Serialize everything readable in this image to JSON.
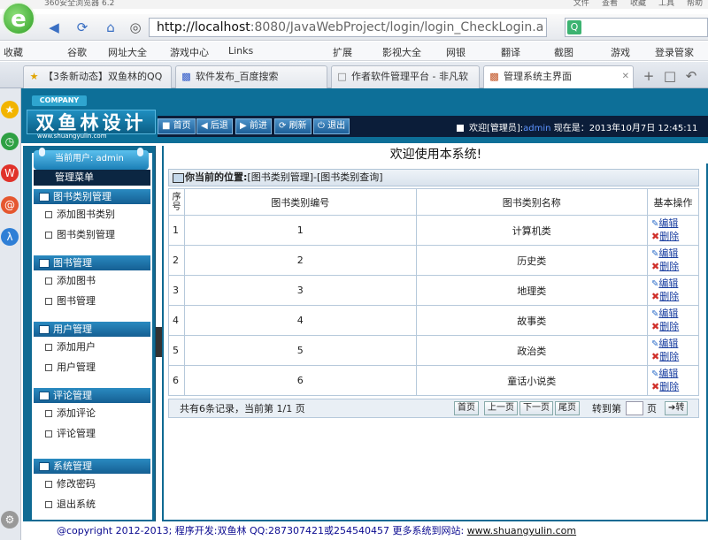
{
  "browser": {
    "title": "360安全浏览器 6.2",
    "menu": [
      "文件",
      "查看",
      "收藏",
      "工具",
      "帮助"
    ],
    "address_host": "http://localhost",
    "address_path": ":8080/JavaWebProject/login/login_CheckLogin.a",
    "bookmarks": [
      "收藏",
      "谷歌",
      "网址大全",
      "游戏中心",
      "Links",
      "扩展",
      "影视大全",
      "网银",
      "翻译",
      "截图",
      "游戏",
      "登录管家"
    ],
    "tabs": [
      {
        "label": "【3条新动态】双鱼林的QQ",
        "active": false
      },
      {
        "label": "软件发布_百度搜索",
        "active": false
      },
      {
        "label": "作者软件管理平台 - 非凡软",
        "active": false
      },
      {
        "label": "管理系统主界面",
        "active": true
      }
    ]
  },
  "header": {
    "company": "COMPANY",
    "brand": "双鱼林设计",
    "brand_url": "www.shuangyulin.com",
    "buttons": [
      "首页",
      "后退",
      "前进",
      "刷新",
      "退出"
    ],
    "welcome_prefix": "欢迎[管理员]:",
    "welcome_user": "admin",
    "welcome_time": "现在是：2013年10月7日  12:45:11"
  },
  "sidebar": {
    "current_user": "当前用户: admin",
    "menu_title": "管理菜单",
    "groups": [
      {
        "title": "图书类别管理",
        "items": [
          "添加图书类别",
          "图书类别管理"
        ]
      },
      {
        "title": "图书管理",
        "items": [
          "添加图书",
          "图书管理"
        ]
      },
      {
        "title": "用户管理",
        "items": [
          "添加用户",
          "用户管理"
        ]
      },
      {
        "title": "评论管理",
        "items": [
          "添加评论",
          "评论管理"
        ]
      },
      {
        "title": "系统管理",
        "items": [
          "修改密码",
          "退出系统"
        ]
      }
    ]
  },
  "main": {
    "welcome": "欢迎使用本系统!",
    "location_label": "你当前的位置:",
    "location_path": "[图书类别管理]-[图书类别查询]",
    "columns": [
      "序号",
      "图书类别编号",
      "图书类别名称",
      "基本操作"
    ],
    "rows": [
      {
        "idx": "1",
        "code": "1",
        "name": "计算机类"
      },
      {
        "idx": "2",
        "code": "2",
        "name": "历史类"
      },
      {
        "idx": "3",
        "code": "3",
        "name": "地理类"
      },
      {
        "idx": "4",
        "code": "4",
        "name": "故事类"
      },
      {
        "idx": "5",
        "code": "5",
        "name": "政治类"
      },
      {
        "idx": "6",
        "code": "6",
        "name": "童话小说类"
      }
    ],
    "edit_label": "编辑",
    "delete_label": "删除",
    "pager_info": "共有6条记录，当前第 1/1 页",
    "pager_buttons": [
      "首页",
      "上一页",
      "下一页",
      "尾页"
    ],
    "goto_label": "转到第",
    "goto_unit": "页",
    "goto_button": "转"
  },
  "footer": {
    "text": "@copyright 2012-2013; 程序开发:双鱼林  QQ:287307421或254540457  更多系统到网站:",
    "url": "www.shuangyulin.com"
  }
}
